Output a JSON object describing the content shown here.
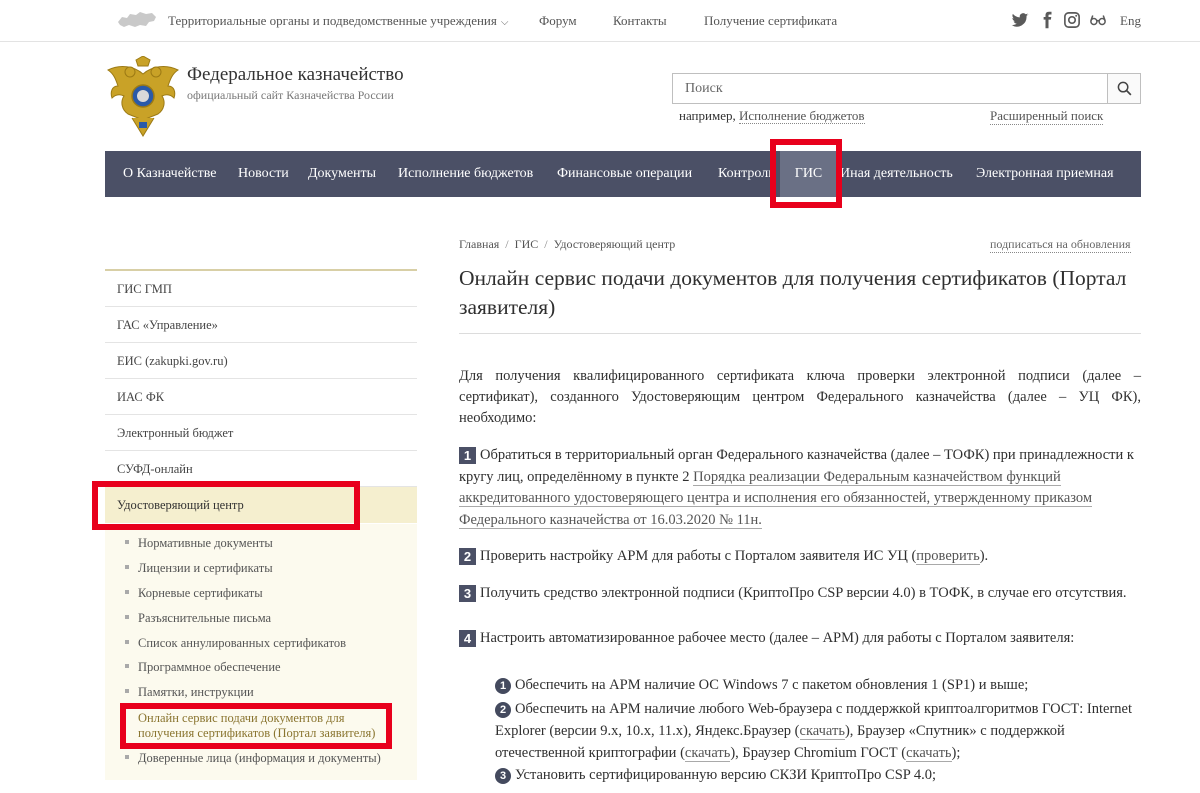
{
  "topbar": {
    "territorial": "Территориальные органы и подведомственные учреждения",
    "forum": "Форум",
    "contacts": "Контакты",
    "certificate": "Получение сертификата",
    "lang": "Eng",
    "social_icons": [
      "twitter-icon",
      "facebook-icon",
      "instagram-icon",
      "glasses-icon"
    ]
  },
  "header": {
    "title": "Федеральное казначейство",
    "subtitle": "официальный сайт Казначейства России"
  },
  "search": {
    "placeholder": "Поиск",
    "hint_prefix": "например, ",
    "hint_example": "Исполнение бюджетов",
    "advanced": "Расширенный поиск"
  },
  "nav": {
    "items": [
      "О Казначействе",
      "Новости",
      "Документы",
      "Исполнение бюджетов",
      "Финансовые операции",
      "Контроль",
      "ГИС",
      "Иная деятельность",
      "Электронная приемная"
    ],
    "active": "ГИС",
    "bg_color": "#4b5066",
    "active_color": "#6a7085"
  },
  "breadcrumb": [
    "Главная",
    "ГИС",
    "Удостоверяющий центр"
  ],
  "subscribe": "подписаться на обновления",
  "page_title": "Онлайн сервис подачи документов для получения сертификатов (Портал заявителя)",
  "sidebar": {
    "items": [
      "ГИС ГМП",
      "ГАС «Управление»",
      "ЕИС (zakupki.gov.ru)",
      "ИАС ФК",
      "Электронный бюджет",
      "СУФД-онлайн",
      "Удостоверяющий центр"
    ],
    "subitems": [
      "Нормативные документы",
      "Лицензии и сертификаты",
      "Корневые сертификаты",
      "Разъяснительные письма",
      "Список аннулированных сертификатов",
      "Программное обеспечение",
      "Памятки, инструкции"
    ],
    "current_line1": "Онлайн сервис подачи документов для",
    "current_line2": "получения сертификатов (Портал заявителя)",
    "last_subitem": "Доверенные лица (информация и документы)"
  },
  "content": {
    "intro": "Для получения квалифицированного сертификата ключа проверки электронной подписи (далее – сертификат), созданного Удостоверяющим центром Федерального казначейства (далее – УЦ ФК), необходимо:",
    "step1_num": "1",
    "step1_text": "Обратиться в территориальный орган Федерального казначейства (далее – ТОФК) при принадлежности к кругу лиц, определённому в пункте 2 ",
    "step1_link": "Порядка реализации Федеральным казначейством функций аккредитованного удостоверяющего центра и исполнения его обязанностей, утвержденному приказом Федерального казначейства от 16.03.2020 № 11н.",
    "step2_num": "2",
    "step2_text": "Проверить настройку АРМ для работы с Порталом заявителя ИС УЦ (",
    "step2_link": "проверить",
    "step2_end": ").",
    "step3_num": "3",
    "step3_text": "Получить средство электронной подписи (КриптоПро CSP версии 4.0) в ТОФК, в случае его отсутствия.",
    "step4_num": "4",
    "step4_text": "Настроить автоматизированное рабочее место (далее – АРМ) для работы с Порталом заявителя:",
    "sub1_num": "1",
    "sub1_text": "Обеспечить на АРМ наличие ОС Windows 7 с пакетом обновления 1 (SP1) и выше;",
    "sub2_num": "2",
    "sub2_a": "Обеспечить на АРМ наличие любого Web-браузера с поддержкой криптоалгоритмов ГОСТ: Internet",
    "sub2_b1": "Explorer (версии 9.x, 10.x, 11.x), Яндекс.Браузер (",
    "sub2_link1": "скачать",
    "sub2_b2": "), Браузер «Спутник» с поддержкой",
    "sub2_c1": "отечественной криптографии (",
    "sub2_link2": "скачать",
    "sub2_c2": "), Браузер Chromium ГОСТ (",
    "sub2_link3": "скачать",
    "sub2_c3": ");",
    "sub3_num": "3",
    "sub3_text": "Установить сертифицированную версию СКЗИ КриптоПро CSP 4.0;"
  },
  "colors": {
    "highlight": "#e8001c",
    "sidebar_active_bg": "#f5efcf",
    "link_current": "#8a7530"
  }
}
